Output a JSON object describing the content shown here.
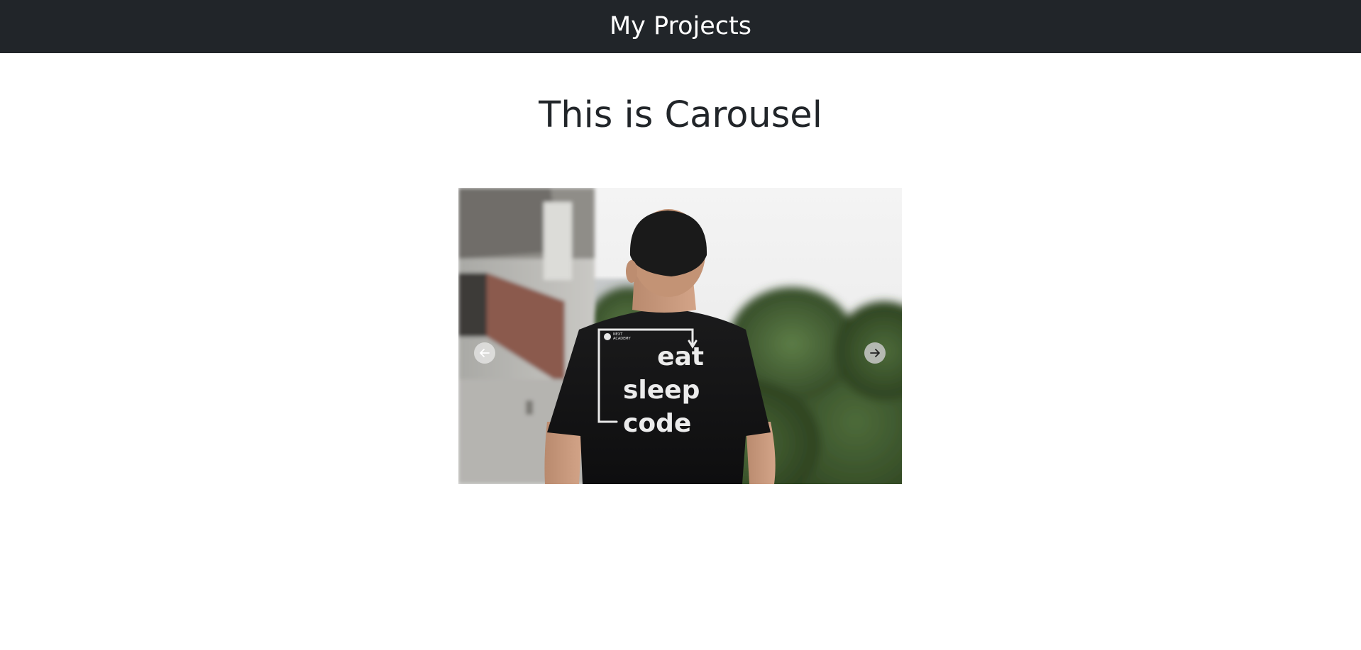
{
  "navbar": {
    "title": "My Projects",
    "background": "#212529"
  },
  "main": {
    "heading": "This is Carousel"
  },
  "carousel": {
    "slide": {
      "description_icon": "photo-man-tshirt",
      "shirt_text": [
        "eat",
        "sleep",
        "code"
      ]
    },
    "prev_icon": "arrow-left-icon",
    "next_icon": "arrow-right-icon"
  }
}
